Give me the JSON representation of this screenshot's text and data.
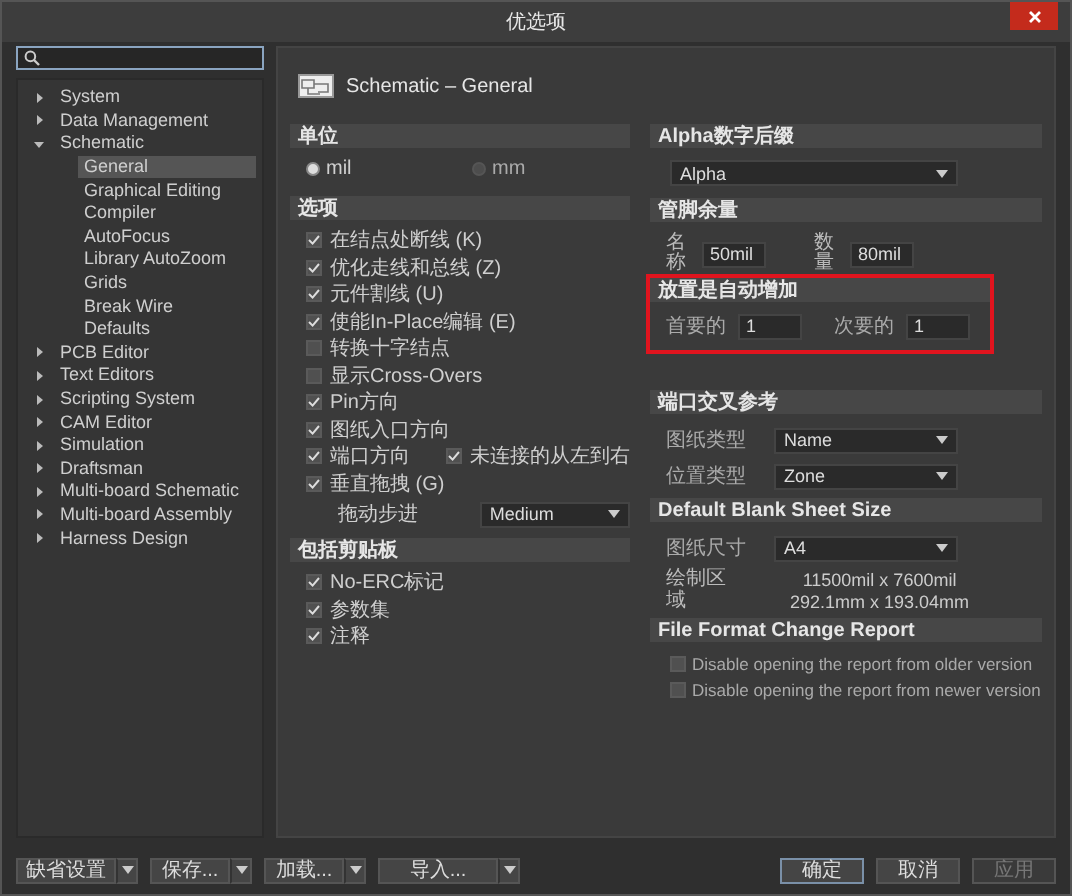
{
  "window": {
    "title": "优选项"
  },
  "tree": [
    {
      "label": "System",
      "expanded": false,
      "selected": false
    },
    {
      "label": "Data Management",
      "expanded": false,
      "selected": false
    },
    {
      "label": "Schematic",
      "expanded": true,
      "selected": false,
      "children": [
        {
          "label": "General",
          "selected": true
        },
        {
          "label": "Graphical Editing",
          "selected": false
        },
        {
          "label": "Compiler",
          "selected": false
        },
        {
          "label": "AutoFocus",
          "selected": false
        },
        {
          "label": "Library AutoZoom",
          "selected": false
        },
        {
          "label": "Grids",
          "selected": false
        },
        {
          "label": "Break Wire",
          "selected": false
        },
        {
          "label": "Defaults",
          "selected": false
        }
      ]
    },
    {
      "label": "PCB Editor",
      "expanded": false,
      "selected": false
    },
    {
      "label": "Text Editors",
      "expanded": false,
      "selected": false
    },
    {
      "label": "Scripting System",
      "expanded": false,
      "selected": false
    },
    {
      "label": "CAM Editor",
      "expanded": false,
      "selected": false
    },
    {
      "label": "Simulation",
      "expanded": false,
      "selected": false
    },
    {
      "label": "Draftsman",
      "expanded": false,
      "selected": false
    },
    {
      "label": "Multi-board Schematic",
      "expanded": false,
      "selected": false
    },
    {
      "label": "Multi-board Assembly",
      "expanded": false,
      "selected": false
    },
    {
      "label": "Harness Design",
      "expanded": false,
      "selected": false
    }
  ],
  "page_title": "Schematic – General",
  "units": {
    "title": "单位",
    "options": [
      {
        "label": "mil",
        "selected": true
      },
      {
        "label": "mm",
        "selected": false
      }
    ]
  },
  "options": {
    "title": "选项",
    "items": [
      {
        "label": "在结点处断线 (K)",
        "checked": true
      },
      {
        "label": "优化走线和总线 (Z)",
        "checked": true
      },
      {
        "label": "元件割线 (U)",
        "checked": true
      },
      {
        "label": "使能In-Place编辑 (E)",
        "checked": true
      },
      {
        "label": "转换十字结点",
        "checked": false
      },
      {
        "label": "显示Cross-Overs",
        "checked": false
      },
      {
        "label": "Pin方向",
        "checked": true
      },
      {
        "label": "图纸入口方向",
        "checked": true
      },
      {
        "label": "端口方向",
        "checked": true,
        "side": {
          "label": "未连接的从左到右",
          "checked": true
        }
      },
      {
        "label": "垂直拖拽 (G)",
        "checked": true
      }
    ],
    "drag_step": {
      "label": "拖动步进",
      "value": "Medium"
    }
  },
  "clipboard": {
    "title": "包括剪贴板",
    "items": [
      {
        "label": "No-ERC标记",
        "checked": true
      },
      {
        "label": "参数集",
        "checked": true
      },
      {
        "label": "注释",
        "checked": true
      }
    ]
  },
  "alpha_suffix": {
    "title": "Alpha数字后缀",
    "value": "Alpha"
  },
  "pin_margin": {
    "title": "管脚余量",
    "fields": [
      {
        "label": "名称",
        "value": "50mil"
      },
      {
        "label": "数量",
        "value": "80mil"
      }
    ]
  },
  "auto_increment": {
    "title": "放置是自动增加",
    "highlighted": true,
    "fields": [
      {
        "label": "首要的",
        "value": "1"
      },
      {
        "label": "次要的",
        "value": "1"
      }
    ]
  },
  "port_cross_ref": {
    "title": "端口交叉参考",
    "rows": [
      {
        "label": "图纸类型",
        "value": "Name"
      },
      {
        "label": "位置类型",
        "value": "Zone"
      }
    ]
  },
  "default_sheet": {
    "title": "Default Blank Sheet Size",
    "size": {
      "label": "图纸尺寸",
      "value": "A4"
    },
    "area": {
      "label": "绘制区域",
      "lines": [
        "11500mil x 7600mil",
        "292.1mm x 193.04mm"
      ]
    }
  },
  "file_format": {
    "title": "File Format Change Report",
    "options": [
      {
        "label": "Disable opening the report from older version",
        "checked": false
      },
      {
        "label": "Disable opening the report from newer version",
        "checked": false
      }
    ]
  },
  "footer": {
    "left_buttons": [
      {
        "label": "缺省设置"
      },
      {
        "label": "保存..."
      },
      {
        "label": "加载..."
      },
      {
        "label": "导入..."
      }
    ],
    "right_buttons": [
      {
        "label": "确定",
        "focused": true,
        "disabled": false
      },
      {
        "label": "取消",
        "focused": false,
        "disabled": false
      },
      {
        "label": "应用",
        "focused": false,
        "disabled": true
      }
    ]
  }
}
